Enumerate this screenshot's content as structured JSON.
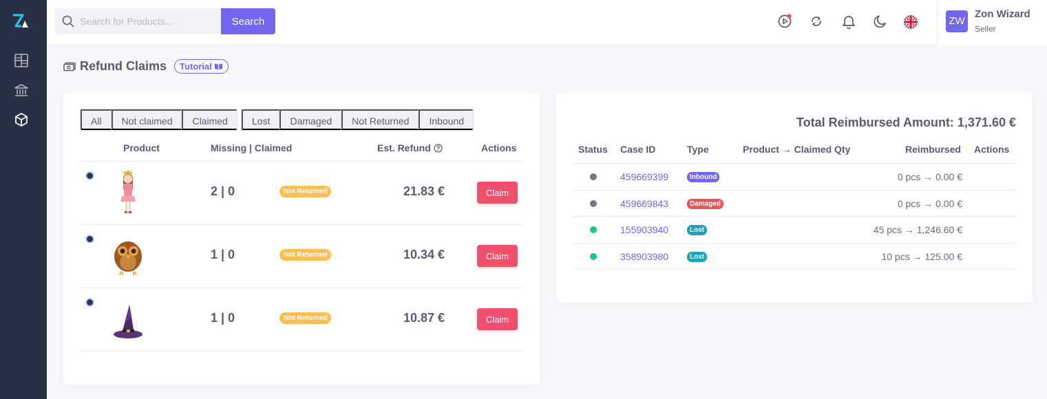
{
  "sidebar": {
    "items": [
      {
        "icon": "dashboard-grid-icon"
      },
      {
        "icon": "bank-icon"
      },
      {
        "icon": "package-box-icon"
      }
    ]
  },
  "header": {
    "search_placeholder": "Search for Products...",
    "search_button": "Search",
    "icons": [
      "play-circle-icon",
      "refresh-icon",
      "bell-icon",
      "moon-icon",
      "uk-flag-icon"
    ],
    "user": {
      "initials": "ZW",
      "name": "Zon Wizard",
      "role": "Seller"
    }
  },
  "page": {
    "title": "Refund Claims",
    "tutorial_label": "Tutorial"
  },
  "claims": {
    "filters_claim_status": [
      "All",
      "Not claimed",
      "Claimed"
    ],
    "filters_type": [
      "Lost",
      "Damaged",
      "Not Returned",
      "Inbound"
    ],
    "columns": {
      "product": "Product",
      "missing_claimed": "Missing | Claimed",
      "est_refund": "Est. Refund",
      "actions": "Actions"
    },
    "rows": [
      {
        "product_icon": "princess-figurine-image",
        "missing_claimed": "2 | 0",
        "status": "Not Returned",
        "est_refund": "21.83 €",
        "action": "Claim"
      },
      {
        "product_icon": "owl-plush-image",
        "missing_claimed": "1 | 0",
        "status": "Not Returned",
        "est_refund": "10.34 €",
        "action": "Claim"
      },
      {
        "product_icon": "witch-hat-image",
        "missing_claimed": "1 | 0",
        "status": "Not Returned",
        "est_refund": "10.87 €",
        "action": "Claim"
      }
    ]
  },
  "reimbursements": {
    "total_label": "Total Reimbursed Amount: 1,371.60 €",
    "columns": {
      "status": "Status",
      "case_id": "Case ID",
      "type": "Type",
      "product_qty": "Product → Claimed Qty",
      "reimbursed": "Reimbursed",
      "actions": "Actions"
    },
    "rows": [
      {
        "status_color": "#6e7785",
        "case_id": "459669399",
        "type": "Inbound",
        "type_color": "#7367f0",
        "reimbursed": "0 pcs → 0.00 €"
      },
      {
        "status_color": "#6e7785",
        "case_id": "459669843",
        "type": "Damaged",
        "type_color": "#ea5455",
        "reimbursed": "0 pcs → 0.00 €"
      },
      {
        "status_color": "#1ac793",
        "case_id": "155903940",
        "type": "Lost",
        "type_color": "#1fa1bb",
        "reimbursed": "45 pcs → 1,246.60 €"
      },
      {
        "status_color": "#1ac793",
        "case_id": "358903980",
        "type": "Lost",
        "type_color": "#1fa1bb",
        "reimbursed": "10 pcs → 125.00 €"
      }
    ]
  }
}
